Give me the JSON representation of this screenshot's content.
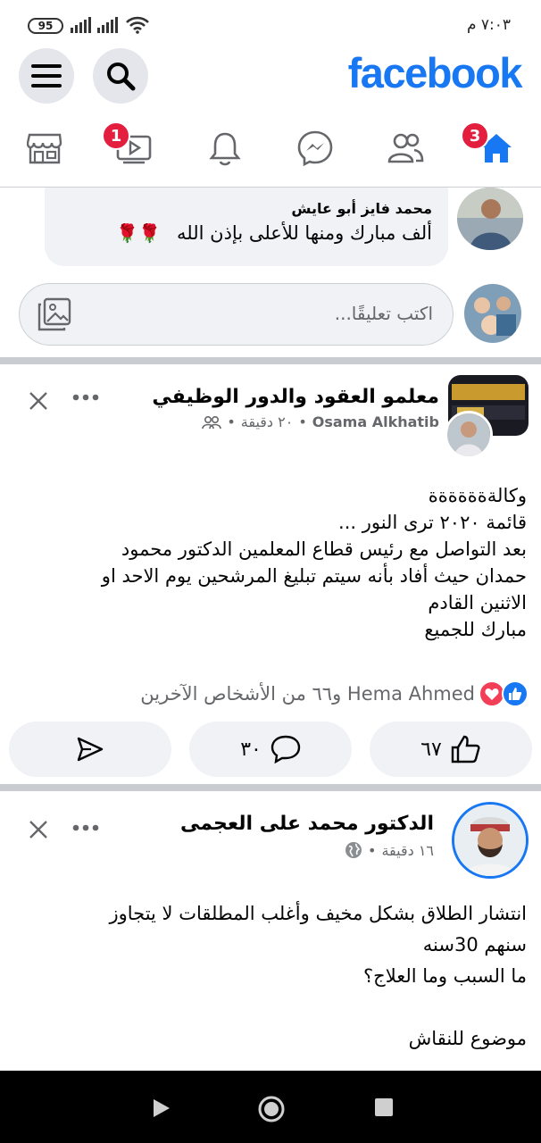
{
  "status_bar": {
    "battery": "95",
    "time": "٧:٠٣ م"
  },
  "header": {
    "logo": "facebook"
  },
  "tabs": [
    {
      "name": "home",
      "badge": "3"
    },
    {
      "name": "friends",
      "badge": ""
    },
    {
      "name": "messenger",
      "badge": ""
    },
    {
      "name": "notifications",
      "badge": ""
    },
    {
      "name": "watch",
      "badge": "1"
    },
    {
      "name": "marketplace",
      "badge": ""
    }
  ],
  "comment": {
    "author": "محمد فايز أبو عايش",
    "text": "ألف مبارك ومنها للأعلى بإذن الله",
    "emoji": "🌹🌹",
    "input_placeholder": "اكتب تعليقًا..."
  },
  "post1": {
    "group": "معلمو العقود والدور الوظيفي",
    "author": "Osama Alkhatib",
    "time": "٢٠ دقيقة",
    "dot": "•",
    "lines": [
      "وكالةةةةةةة",
      "قائمة ٢٠٢٠ ترى النور ...",
      "بعد التواصل مع رئيس قطاع المعلمين الدكتور محمود",
      "حمدان حيث أفاد بأنه سيتم تبليغ المرشحين يوم الاحد او",
      "الاثنين القادم",
      "مبارك للجميع"
    ],
    "reactions_text": "Hema Ahmed و٦٦ من الأشخاص الآخرين",
    "like_count": "٦٧",
    "comment_count": "٣٠"
  },
  "post2": {
    "author": "الدكتور محمد على العجمى",
    "time": "١٦ دقيقة",
    "dot": "•",
    "lines": [
      "انتشار الطلاق بشكل مخيف وأغلب المطلقات لا يتجاوز",
      "سنهم 30سنه",
      "ما السبب وما العلاج؟",
      "",
      "موضوع للنقاش"
    ]
  },
  "colors": {
    "brand": "#1877f2",
    "badge": "#e41e3f",
    "love": "#f33e58"
  }
}
